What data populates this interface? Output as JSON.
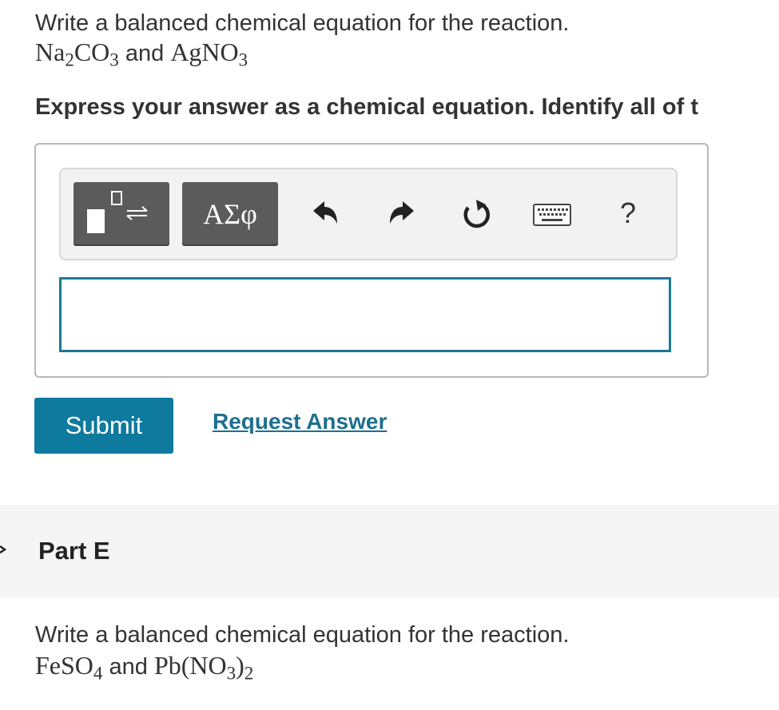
{
  "part_d": {
    "prompt": "Write a balanced chemical equation for the reaction.",
    "reactant1": "Na",
    "reactant1_sub1": "2",
    "reactant1_mid": "CO",
    "reactant1_sub2": "3",
    "connector": "and",
    "reactant2": "AgNO",
    "reactant2_sub": "3",
    "instruction": "Express your answer as a chemical equation. Identify all of t"
  },
  "toolbar": {
    "greek_label": "ΑΣφ",
    "help_label": "?",
    "icons": [
      "templates-icon",
      "undo-icon",
      "redo-icon",
      "reset-icon",
      "keyboard-icon",
      "help-icon"
    ]
  },
  "answer": {
    "value": ""
  },
  "actions": {
    "submit_label": "Submit",
    "request_answer_label": "Request Answer"
  },
  "part_e": {
    "title": "Part E",
    "prompt": "Write a balanced chemical equation for the reaction.",
    "reactant1": "FeSO",
    "reactant1_sub": "4",
    "connector": "and",
    "reactant2_open": "Pb(NO",
    "reactant2_sub1": "3",
    "reactant2_close": ")",
    "reactant2_sub2": "2"
  },
  "colors": {
    "accent": "#0e7a9e",
    "link": "#1d6f8e",
    "input_border": "#1d7a92",
    "toolbar_button": "#5b5b5b"
  }
}
